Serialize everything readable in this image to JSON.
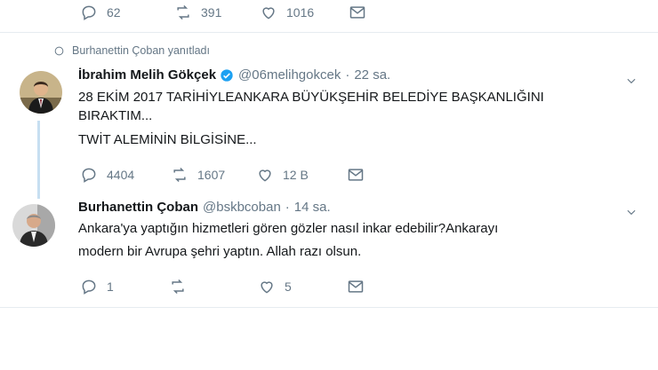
{
  "top_actions": {
    "reply_count": "62",
    "retweet_count": "391",
    "like_count": "1016"
  },
  "replied_label": "Burhanettin Çoban yanıtladı",
  "tweet1": {
    "name": "İbrahim Melih Gökçek",
    "handle": "@06melihgokcek",
    "dot": "·",
    "time": "22 sa.",
    "line1": "28 EKİM 2017 TARİHİYLEANKARA BÜYÜKŞEHİR BELEDİYE BAŞKANLIĞINI",
    "line2": "BIRAKTIM...",
    "line3": "TWİT ALEMİNİN BİLGİSİNE...",
    "reply_count": "4404",
    "retweet_count": "1607",
    "like_count": "12 B"
  },
  "tweet2": {
    "name": "Burhanettin Çoban",
    "handle": "@bskbcoban",
    "dot": "·",
    "time": "14 sa.",
    "line1": "Ankara'ya yaptığın hizmetleri gören gözler nasıl inkar edebilir?Ankarayı",
    "line2": "modern bir Avrupa şehri yaptın. Allah razı olsun.",
    "reply_count": "1",
    "retweet_count": "",
    "like_count": "5"
  },
  "colors": {
    "verified": "#1da1f2",
    "thread_line": "#c7dff1",
    "muted": "#657786"
  }
}
